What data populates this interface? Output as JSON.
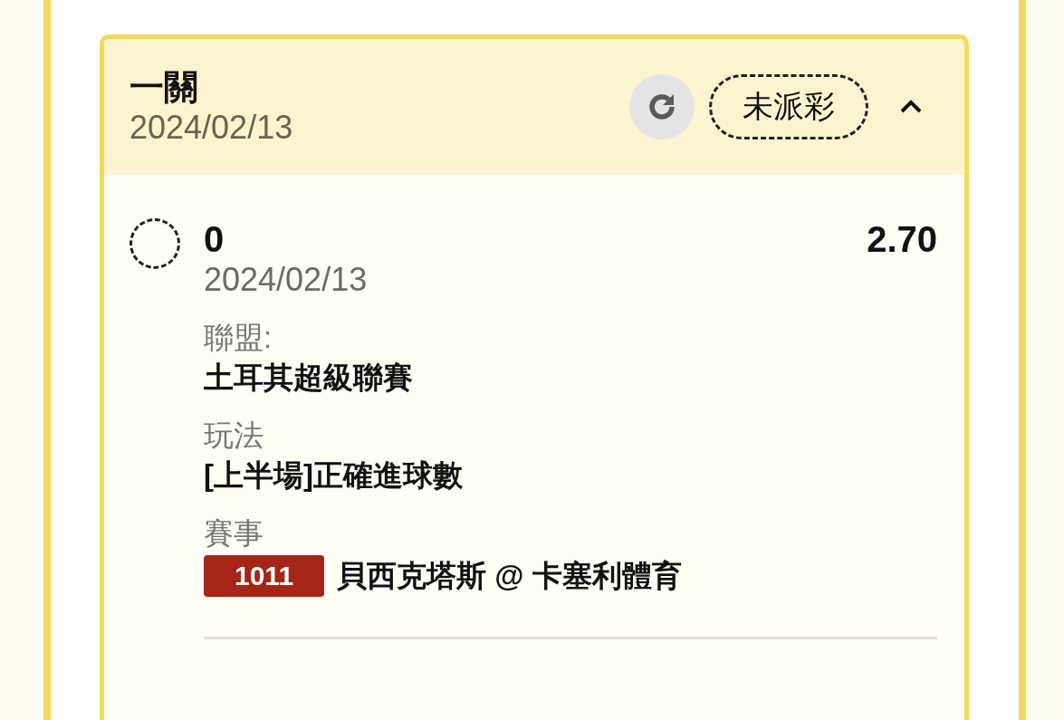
{
  "bet": {
    "title": "一關",
    "date": "2024/02/13",
    "status": "未派彩",
    "expanded": true
  },
  "legs": [
    {
      "selected": false,
      "selection": "0",
      "date": "2024/02/13",
      "odds": "2.70",
      "fields": [
        {
          "label": "聯盟:",
          "value": "土耳其超級聯賽"
        },
        {
          "label": "玩法",
          "value": "[上半場]正確進球數"
        }
      ],
      "match": {
        "label": "賽事",
        "number": "1011",
        "teams": "貝西克塔斯 @ 卡塞利體育"
      }
    }
  ]
}
